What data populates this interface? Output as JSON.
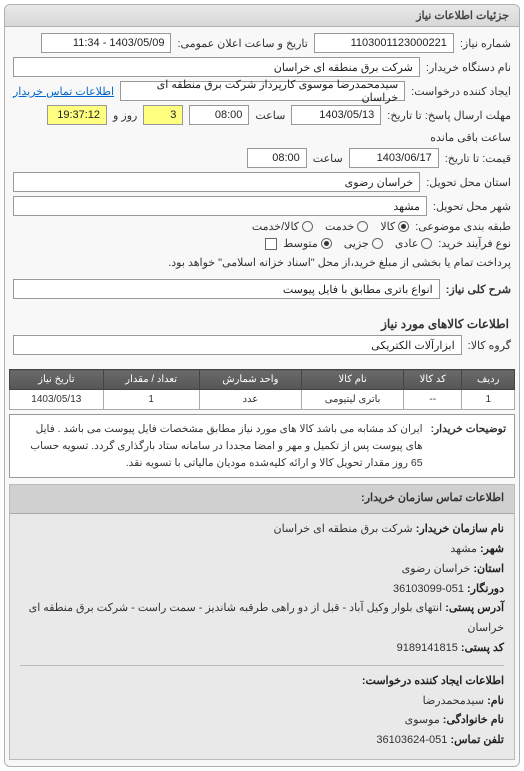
{
  "panel_title": "جزئیات اطلاعات نیاز",
  "labels": {
    "req_no": "شماره نیاز:",
    "public_date": "تاریخ و ساعت اعلان عمومی:",
    "org_name": "نام دستگاه خریدار:",
    "creator": "ایجاد کننده درخواست:",
    "buyer_contact": "اطلاعات تماس خریدار",
    "deadline": "مهلت ارسال پاسخ: تا تاریخ:",
    "time": "ساعت",
    "days_remain": "روز و",
    "time_remain": "ساعت باقی مانده",
    "price_until": "قیمت: تا تاریخ:",
    "delivery_province": "استان محل تحویل:",
    "delivery_city": "شهر محل تحویل:",
    "subject_cat": "طبقه بندی موضوعی:",
    "priority": "نوع فرآیند خرید:",
    "payment_note": "پرداخت تمام یا بخشی از مبلغ خرید،از محل \"اسناد خزانه اسلامی\" خواهد بود.",
    "need_title": "شرح کلی نیاز:",
    "goods_section": "اطلاعات کالاهای مورد نیاز",
    "goods_group": "گروه کالا:"
  },
  "values": {
    "req_no": "1103001123000221",
    "public_date": "1403/05/09 - 11:34",
    "org_name": "شرکت برق منطقه ای خراسان",
    "creator": "سیدمحمدرضا موسوی کارپرداز شرکت برق منطقه ای خراسان",
    "deadline_date": "1403/05/13",
    "deadline_time": "08:00",
    "days_remain": "3",
    "time_remain": "19:37:12",
    "price_date": "1403/06/17",
    "price_time": "08:00",
    "province": "خراسان رضوی",
    "city": "مشهد",
    "need_title": "انواع باتری مطابق با فایل پیوست",
    "goods_group": "ابزارآلات الکتریکی"
  },
  "subject_options": [
    {
      "label": "کالا",
      "checked": true
    },
    {
      "label": "خدمت",
      "checked": false
    },
    {
      "label": "کالا/خدمت",
      "checked": false
    }
  ],
  "priority_options": [
    {
      "label": "عادی",
      "checked": false
    },
    {
      "label": "جزیی",
      "checked": false
    },
    {
      "label": "متوسط",
      "checked": true
    }
  ],
  "table": {
    "headers": [
      "ردیف",
      "کد کالا",
      "نام کالا",
      "واحد شمارش",
      "تعداد / مقدار",
      "تاریخ نیاز"
    ],
    "rows": [
      [
        "1",
        "--",
        "باتری لیتیومی",
        "عدد",
        "1",
        "1403/05/13"
      ]
    ]
  },
  "description": {
    "label": "توضیحات خریدار:",
    "text": "ایران کد مشابه می باشد کالا های مورد نیاز مطابق مشخصات فایل پیوست می باشد . فایل های پیوست پس از تکمیل و مهر و امضا مجددا در سامانه ستاد بارگذاری گردد. تسویه حساب 65 روز مقدار تحویل کالا و ارائه کلیه‌شده مودیان مالیاتی با تسویه نقد."
  },
  "contact": {
    "title": "اطلاعات تماس سازمان خریدار:",
    "org_label": "نام سازمان خریدار:",
    "org": "شرکت برق منطقه ای خراسان",
    "city_label": "شهر:",
    "city": "مشهد",
    "province_label": "استان:",
    "province": "خراسان رضوی",
    "fax_label": "دورنگار:",
    "fax": "051-36103099",
    "addr_label": "آدرس پستی:",
    "addr": "انتهای بلوار وکیل آباد - قبل از دو راهی طرقبه شاندیز - سمت راست - شرکت برق منطقه ای خراسان",
    "postal_label": "کد پستی:",
    "postal": "9189141815",
    "creator_section": "اطلاعات ایجاد کننده درخواست:",
    "name_label": "نام:",
    "name": "سیدمحمدرضا",
    "lname_label": "نام خانوادگی:",
    "lname": "موسوی",
    "phone_label": "تلفن تماس:",
    "phone": "051-36103624"
  }
}
